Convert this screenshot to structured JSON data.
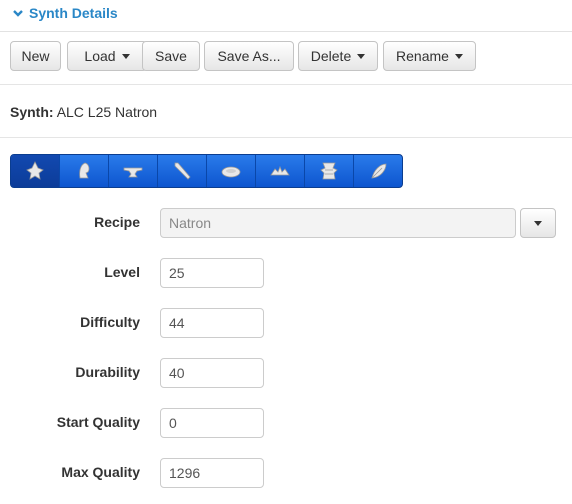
{
  "panel": {
    "title": "Synth Details"
  },
  "toolbar": {
    "new_label": "New",
    "load_label": "Load",
    "save_label": "Save",
    "save_as_label": "Save As...",
    "delete_label": "Delete",
    "rename_label": "Rename"
  },
  "synth": {
    "label": "Synth:",
    "name": "ALC L25 Natron"
  },
  "classes": [
    {
      "icon": "alchemist-icon",
      "active": true
    },
    {
      "icon": "armorer-icon",
      "active": false
    },
    {
      "icon": "blacksmith-icon",
      "active": false
    },
    {
      "icon": "carpenter-icon",
      "active": false
    },
    {
      "icon": "culinarian-icon",
      "active": false
    },
    {
      "icon": "goldsmith-icon",
      "active": false
    },
    {
      "icon": "leatherworker-icon",
      "active": false
    },
    {
      "icon": "weaver-icon",
      "active": false
    }
  ],
  "form": {
    "recipe_label": "Recipe",
    "recipe_value": "Natron",
    "level_label": "Level",
    "level_value": "25",
    "difficulty_label": "Difficulty",
    "difficulty_value": "44",
    "durability_label": "Durability",
    "durability_value": "40",
    "start_quality_label": "Start Quality",
    "start_quality_value": "0",
    "max_quality_label": "Max Quality",
    "max_quality_value": "1296"
  },
  "colors": {
    "accent": "#2a87c7",
    "class_bar": "#1a66df"
  }
}
